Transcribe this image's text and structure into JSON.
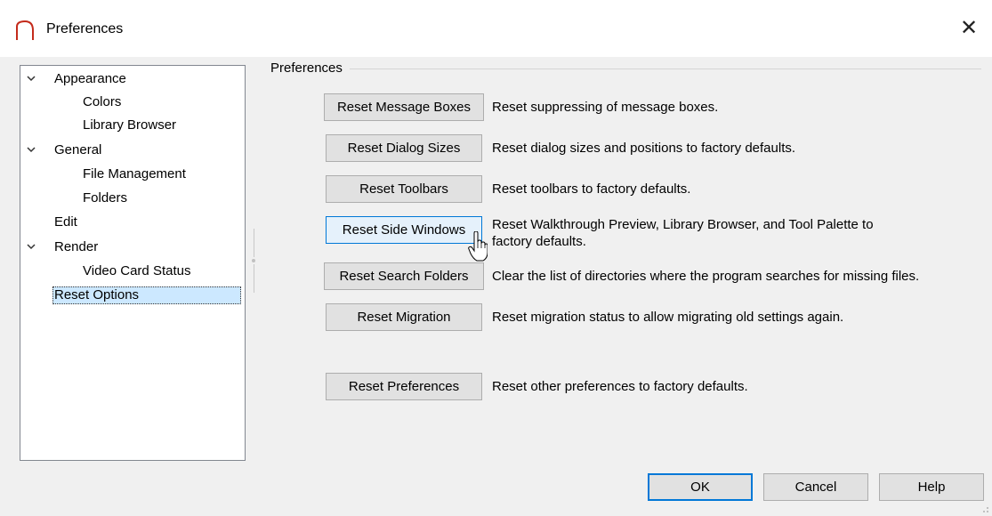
{
  "window": {
    "title": "Preferences",
    "close_glyph": "✕",
    "app_icon": "arch-logo-icon",
    "accent_color": "#0078d7",
    "logo_color": "#c42b1c"
  },
  "tree": {
    "items": [
      {
        "label": "Appearance",
        "level": 0,
        "expanded": true
      },
      {
        "label": "Colors",
        "level": 1
      },
      {
        "label": "Library Browser",
        "level": 1
      },
      {
        "label": "General",
        "level": 0,
        "expanded": true
      },
      {
        "label": "File Management",
        "level": 1
      },
      {
        "label": "Folders",
        "level": 1
      },
      {
        "label": "Edit",
        "level": 0
      },
      {
        "label": "Render",
        "level": 0,
        "expanded": true
      },
      {
        "label": "Video Card Status",
        "level": 1
      },
      {
        "label": "Reset Options",
        "level": 0,
        "selected": true
      }
    ]
  },
  "group": {
    "title": "Preferences"
  },
  "reset_rows": [
    {
      "button": "Reset Message Boxes",
      "description": "Reset suppressing of message boxes."
    },
    {
      "button": "Reset Dialog Sizes",
      "description": "Reset dialog sizes and positions to factory defaults."
    },
    {
      "button": "Reset Toolbars",
      "description": "Reset toolbars to factory defaults."
    },
    {
      "button": "Reset Side Windows",
      "description_line1": "Reset Walkthrough Preview, Library Browser, and Tool Palette to",
      "description_line2": "factory defaults."
    },
    {
      "button": "Reset Search Folders",
      "description": "Clear the list of directories where the program searches for missing files."
    },
    {
      "button": "Reset Migration",
      "description": "Reset migration status to allow migrating old settings again."
    },
    {
      "button": "Reset Preferences",
      "description": "Reset other preferences to factory defaults."
    }
  ],
  "footer": {
    "ok_label": "OK",
    "cancel_label": "Cancel",
    "help_label": "Help"
  }
}
